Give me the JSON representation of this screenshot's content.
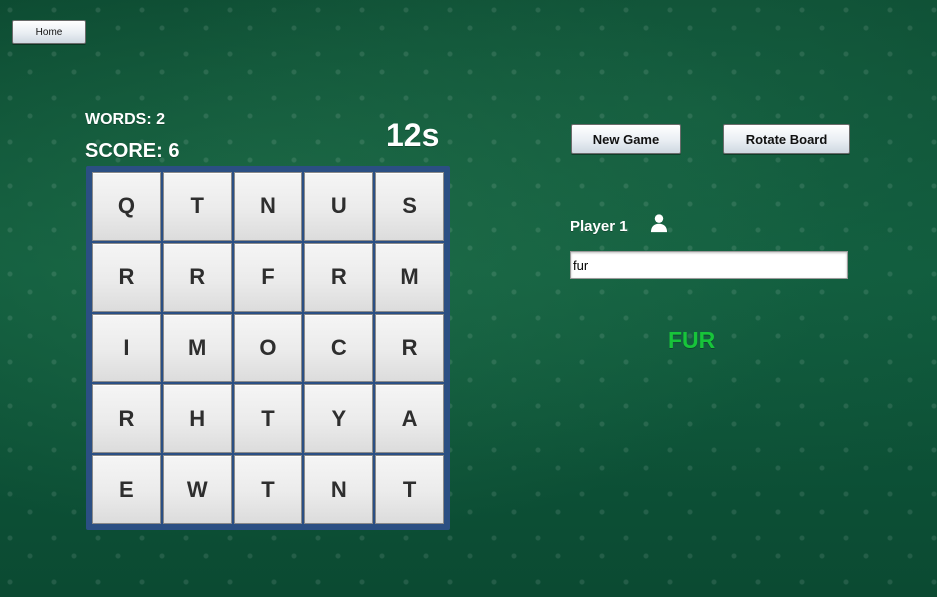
{
  "header": {
    "home_label": "Home"
  },
  "stats": {
    "words_text": "WORDS: 2",
    "score_text": "SCORE: 6",
    "timer_text": "12s"
  },
  "controls": {
    "new_game_label": "New Game",
    "rotate_board_label": "Rotate Board"
  },
  "board": {
    "rows": [
      [
        "Q",
        "T",
        "N",
        "U",
        "S"
      ],
      [
        "R",
        "R",
        "F",
        "R",
        "M"
      ],
      [
        "I",
        "M",
        "O",
        "C",
        "R"
      ],
      [
        "R",
        "H",
        "T",
        "Y",
        "A"
      ],
      [
        "E",
        "W",
        "T",
        "N",
        "T"
      ]
    ]
  },
  "player": {
    "label": "Player 1",
    "icon": "user-icon"
  },
  "input": {
    "value": "fur",
    "placeholder": ""
  },
  "last_word": {
    "text": "FUR"
  },
  "colors": {
    "background": "#0f5a3c",
    "board_frame": "#2b4f83",
    "tile": "#ebebeb",
    "accent_word": "#17c43a"
  }
}
